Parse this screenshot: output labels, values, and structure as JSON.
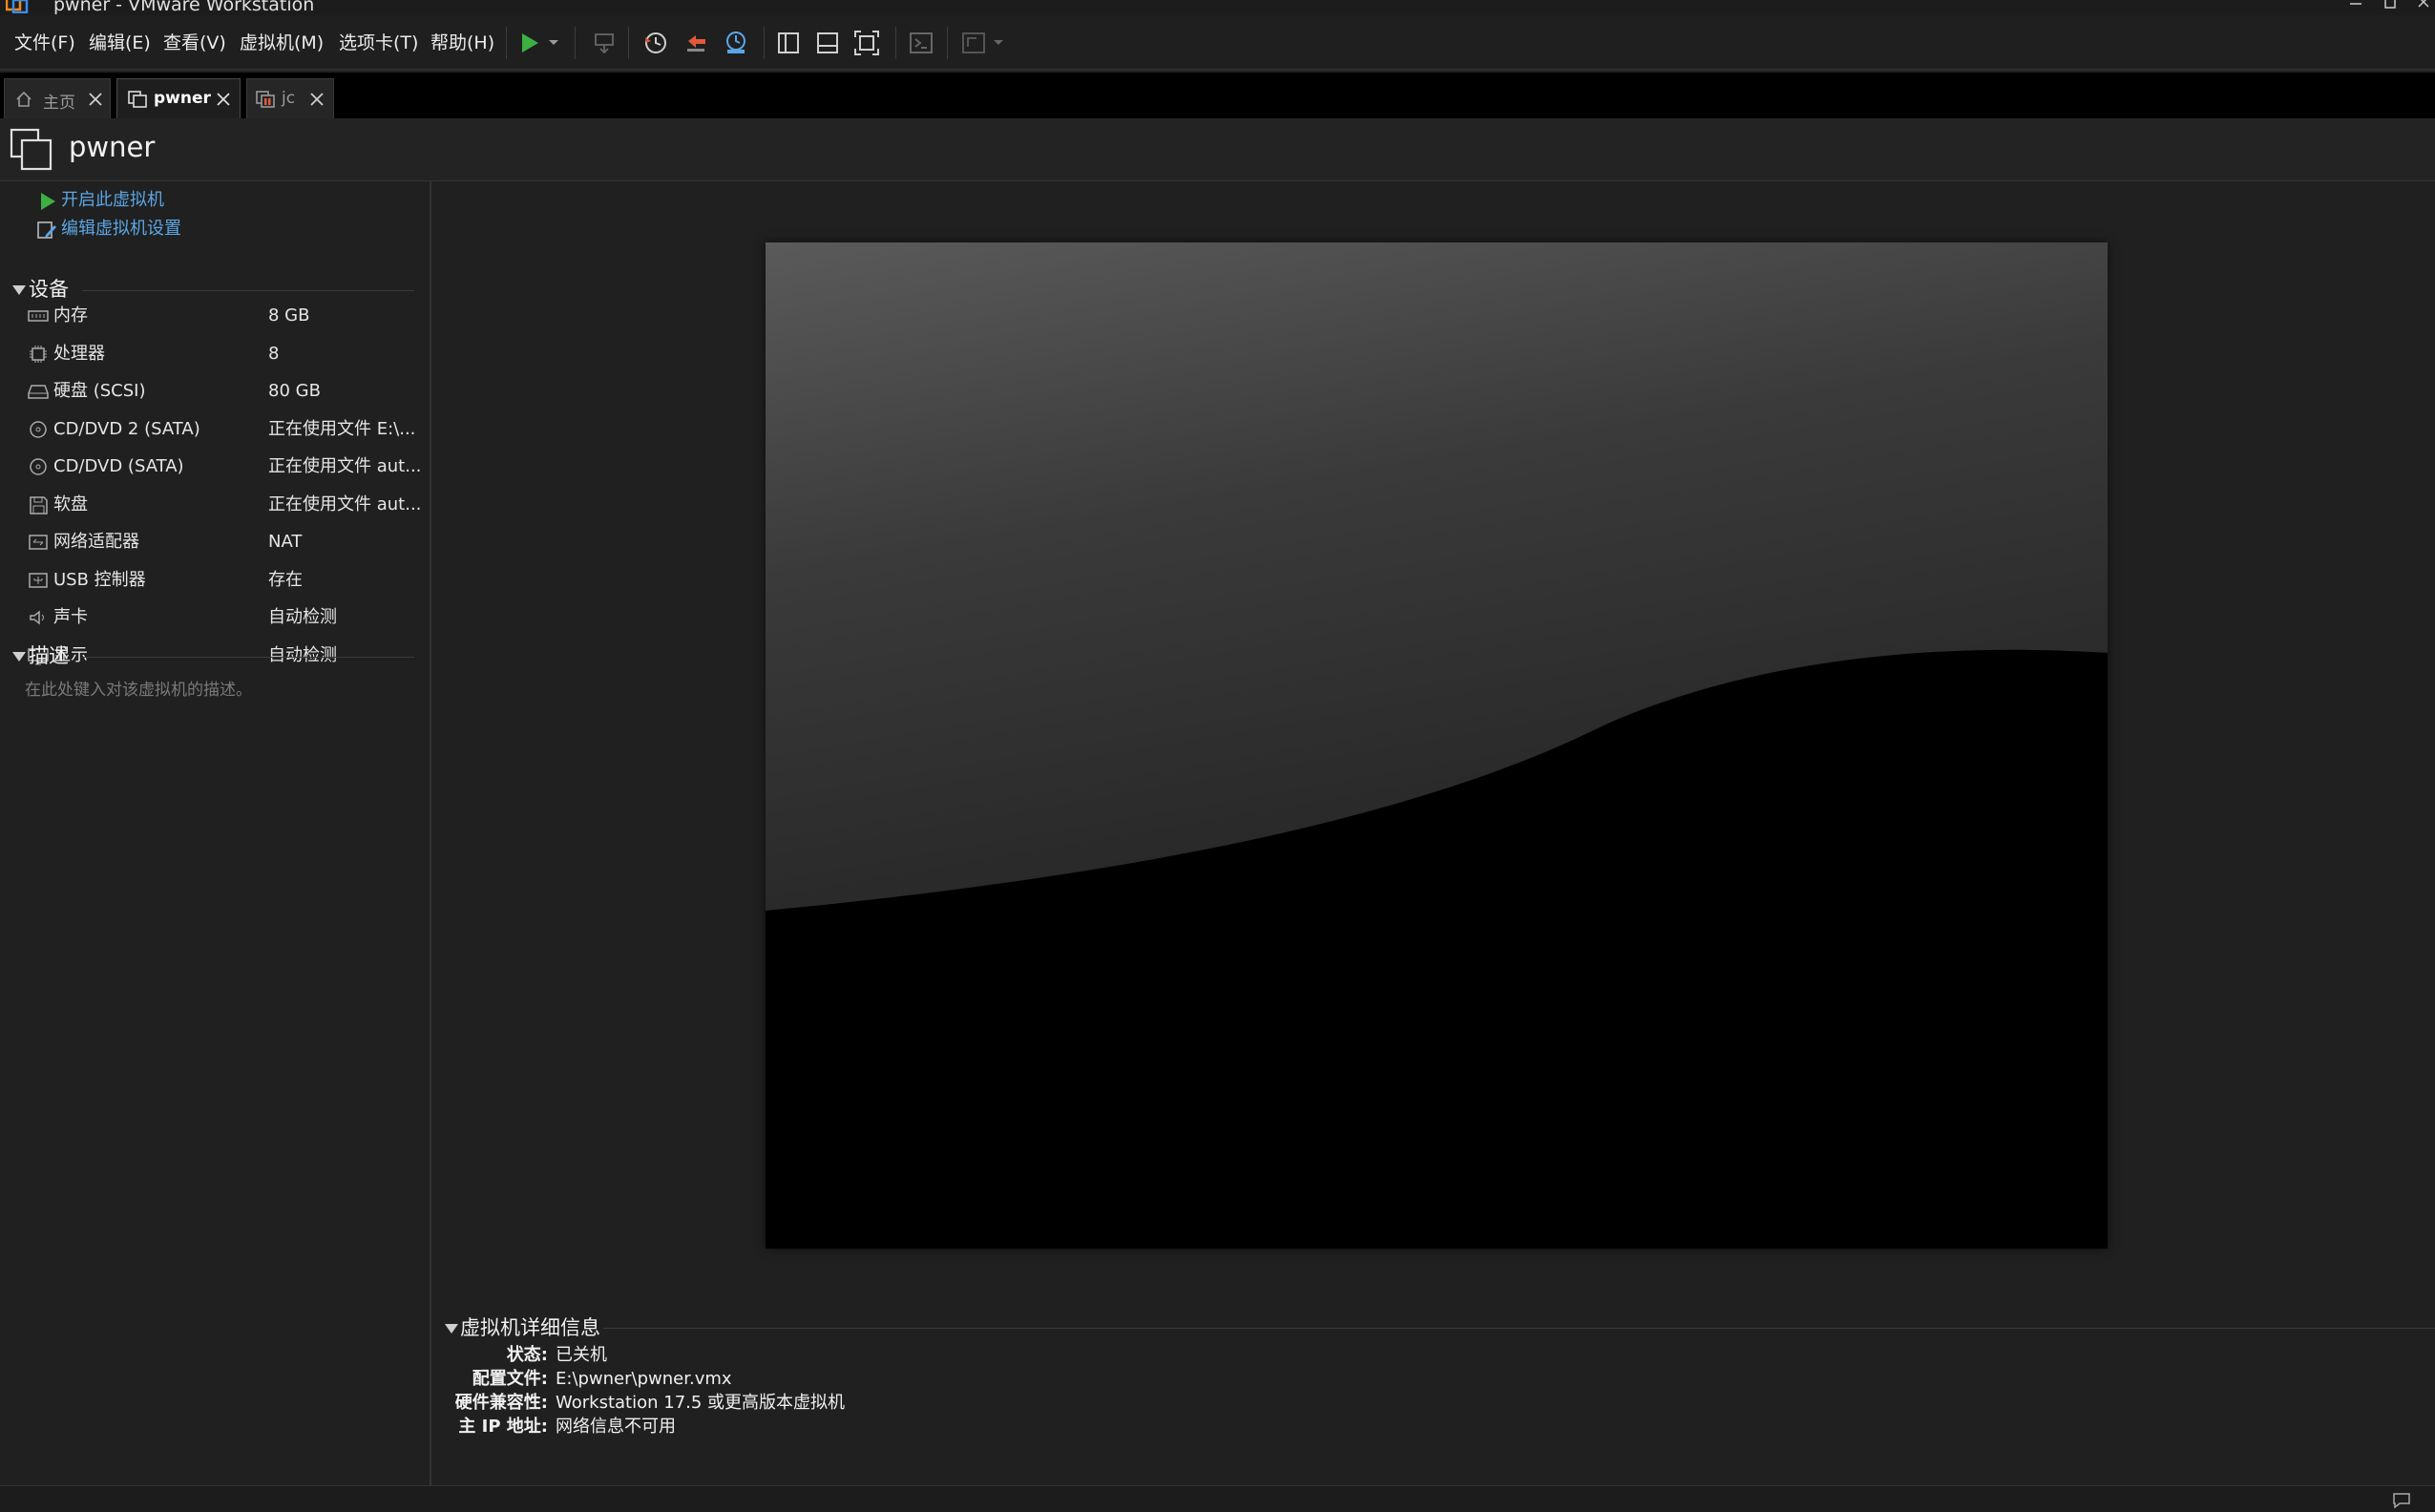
{
  "window": {
    "title": "pwner - VMware Workstation"
  },
  "menu": {
    "file": "文件(F)",
    "edit": "编辑(E)",
    "view": "查看(V)",
    "vm": "虚拟机(M)",
    "tabs": "选项卡(T)",
    "help": "帮助(H)"
  },
  "tabs": [
    {
      "label": "主页",
      "icon": "home-icon",
      "active": false
    },
    {
      "label": "pwner",
      "icon": "vm-icon",
      "active": true
    },
    {
      "label": "jc",
      "icon": "vm-running-icon",
      "active": false
    }
  ],
  "vm": {
    "name": "pwner",
    "actions": {
      "power_on": "开启此虚拟机",
      "edit_settings": "编辑虚拟机设置"
    }
  },
  "devices": {
    "section_title": "设备",
    "items": [
      {
        "name": "内存",
        "value": "8 GB",
        "icon": "memory-icon"
      },
      {
        "name": "处理器",
        "value": "8",
        "icon": "cpu-icon"
      },
      {
        "name": "硬盘 (SCSI)",
        "value": "80 GB",
        "icon": "hard-disk-icon"
      },
      {
        "name": "CD/DVD 2 (SATA)",
        "value": "正在使用文件 E:\\...",
        "icon": "cd-dvd-icon"
      },
      {
        "name": "CD/DVD (SATA)",
        "value": "正在使用文件 aut...",
        "icon": "cd-dvd-icon"
      },
      {
        "name": "软盘",
        "value": "正在使用文件 aut...",
        "icon": "floppy-icon"
      },
      {
        "name": "网络适配器",
        "value": "NAT",
        "icon": "network-adapter-icon"
      },
      {
        "name": "USB 控制器",
        "value": "存在",
        "icon": "usb-icon"
      },
      {
        "name": "声卡",
        "value": "自动检测",
        "icon": "sound-card-icon"
      },
      {
        "name": "显示",
        "value": "自动检测",
        "icon": "display-icon"
      }
    ]
  },
  "description": {
    "section_title": "描述",
    "placeholder": "在此处键入对该虚拟机的描述。"
  },
  "details": {
    "section_title": "虚拟机详细信息",
    "rows": [
      {
        "label": "状态:",
        "value": "已关机"
      },
      {
        "label": "配置文件:",
        "value": "E:\\pwner\\pwner.vmx"
      },
      {
        "label": "硬件兼容性:",
        "value": "Workstation 17.5 或更高版本虚拟机"
      },
      {
        "label": "主 IP 地址:",
        "value": "网络信息不可用"
      }
    ]
  },
  "colors": {
    "accent_link": "#5ba6e6",
    "play_green": "#3cb043",
    "background": "#202020"
  }
}
